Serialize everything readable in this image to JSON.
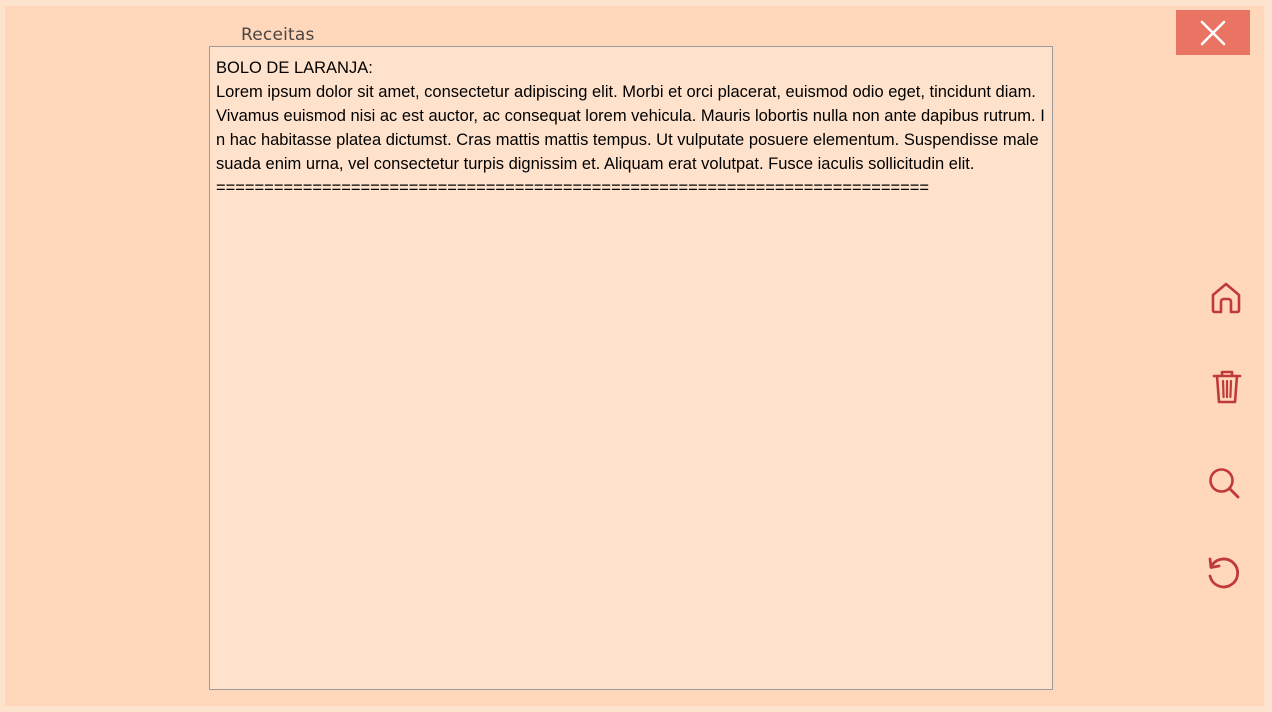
{
  "window": {
    "title": "Receitas"
  },
  "recipe_text": "BOLO DE LARANJA:\nLorem ipsum dolor sit amet, consectetur adipiscing elit. Morbi et orci placerat, euismod odio eget, tincidunt diam. Vivamus euismod nisi ac est auctor, ac consequat lorem vehicula. Mauris lobortis nulla non ante dapibus rutrum. In hac habitasse platea dictumst. Cras mattis mattis tempus. Ut vulputate posuere elementum. Suspendisse malesuada enim urna, vel consectetur turpis dignissim et. Aliquam erat volutpat. Fusce iaculis sollicitudin elit.\n==========================================================================",
  "icons": {
    "close": "close-icon",
    "home": "home-icon",
    "delete": "trash-icon",
    "search": "search-icon",
    "refresh": "refresh-icon"
  },
  "colors": {
    "background": "#ffd7bb",
    "textarea": "#ffe2cc",
    "close_button": "#ea7464",
    "icon_accent": "#c0393b"
  }
}
